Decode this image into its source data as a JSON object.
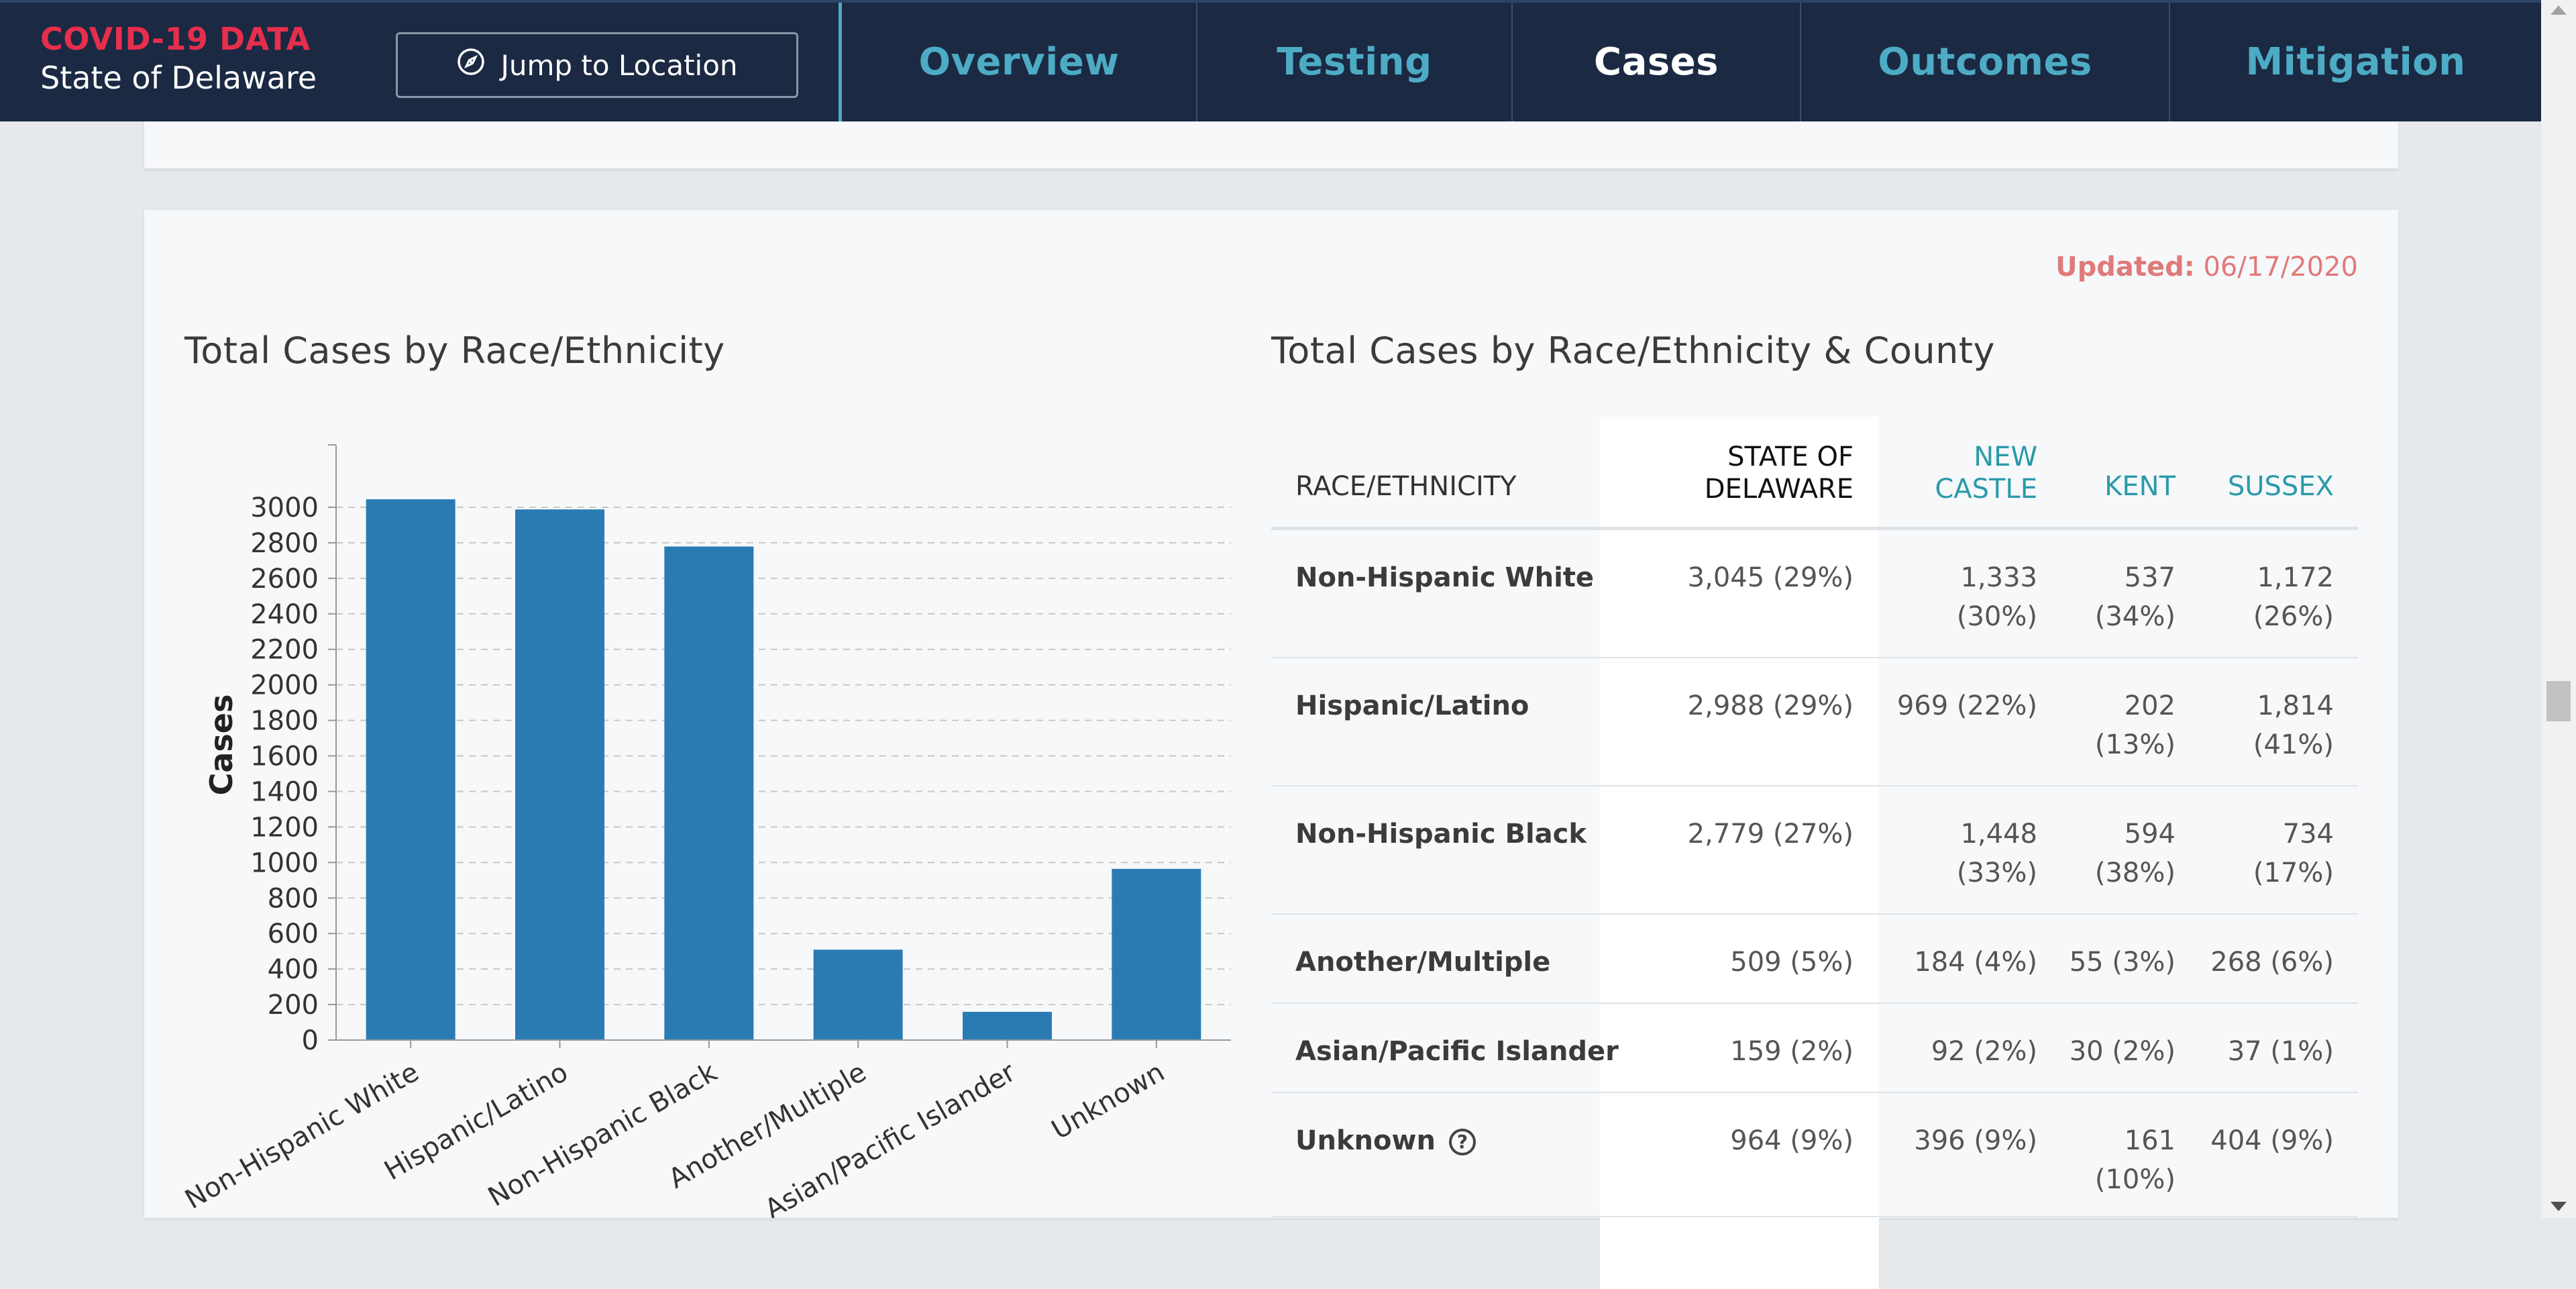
{
  "header": {
    "brand_title": "COVID-19 DATA",
    "brand_subtitle": "State of Delaware",
    "jump_label": "Jump to Location",
    "tabs": [
      {
        "label": "Overview",
        "active": false
      },
      {
        "label": "Testing",
        "active": false
      },
      {
        "label": "Cases",
        "active": true
      },
      {
        "label": "Outcomes",
        "active": false
      },
      {
        "label": "Mitigation",
        "active": false
      }
    ]
  },
  "updated": {
    "label": "Updated:",
    "date": "06/17/2020"
  },
  "colors": {
    "bar": "#2b7bb3",
    "accent_teal": "#2b9aa8",
    "updated": "#e07a7a",
    "brand_red": "#e62e4d",
    "nav_teal": "#4dabc4"
  },
  "chart_title": "Total Cases by Race/Ethnicity",
  "chart_data": {
    "type": "bar",
    "categories": [
      "Non-Hispanic White",
      "Hispanic/Latino",
      "Non-Hispanic Black",
      "Another/Multiple",
      "Asian/Pacific Islander",
      "Unknown"
    ],
    "values": [
      3045,
      2988,
      2779,
      509,
      159,
      964
    ],
    "title": "Total Cases by Race/Ethnicity",
    "xlabel": "",
    "ylabel": "Cases",
    "ylim": [
      0,
      3000
    ],
    "yticks": [
      0,
      200,
      400,
      600,
      800,
      1000,
      1200,
      1400,
      1600,
      1800,
      2000,
      2200,
      2400,
      2600,
      2800,
      3000
    ],
    "grid": true
  },
  "table": {
    "title": "Total Cases by Race/Ethnicity & County",
    "headers": {
      "race": "RACE/ETHNICITY",
      "state_line1": "STATE OF",
      "state_line2": "DELAWARE",
      "newcastle_line1": "NEW",
      "newcastle_line2": "CASTLE",
      "kent": "KENT",
      "sussex": "SUSSEX"
    },
    "rows": [
      {
        "name": "Non-Hispanic White",
        "state": "3,045 (29%)",
        "nc": [
          "1,333",
          "(30%)"
        ],
        "kent": [
          "537",
          "(34%)"
        ],
        "sussex": [
          "1,172",
          "(26%)"
        ]
      },
      {
        "name": "Hispanic/Latino",
        "state": "2,988 (29%)",
        "nc": [
          "969 (22%)"
        ],
        "kent": [
          "202",
          "(13%)"
        ],
        "sussex": [
          "1,814",
          "(41%)"
        ]
      },
      {
        "name": "Non-Hispanic Black",
        "state": "2,779 (27%)",
        "nc": [
          "1,448",
          "(33%)"
        ],
        "kent": [
          "594",
          "(38%)"
        ],
        "sussex": [
          "734",
          "(17%)"
        ]
      },
      {
        "name": "Another/Multiple",
        "state": "509 (5%)",
        "nc": [
          "184 (4%)"
        ],
        "kent": [
          "55 (3%)"
        ],
        "sussex": [
          "268 (6%)"
        ]
      },
      {
        "name": "Asian/Pacific Islander",
        "state": "159 (2%)",
        "nc": [
          "92 (2%)"
        ],
        "kent": [
          "30 (2%)"
        ],
        "sussex": [
          "37 (1%)"
        ]
      },
      {
        "name": "Unknown",
        "state": "964 (9%)",
        "nc": [
          "396 (9%)"
        ],
        "kent": [
          "161",
          "(10%)"
        ],
        "sussex": [
          "404 (9%)"
        ],
        "help": "?"
      }
    ]
  }
}
